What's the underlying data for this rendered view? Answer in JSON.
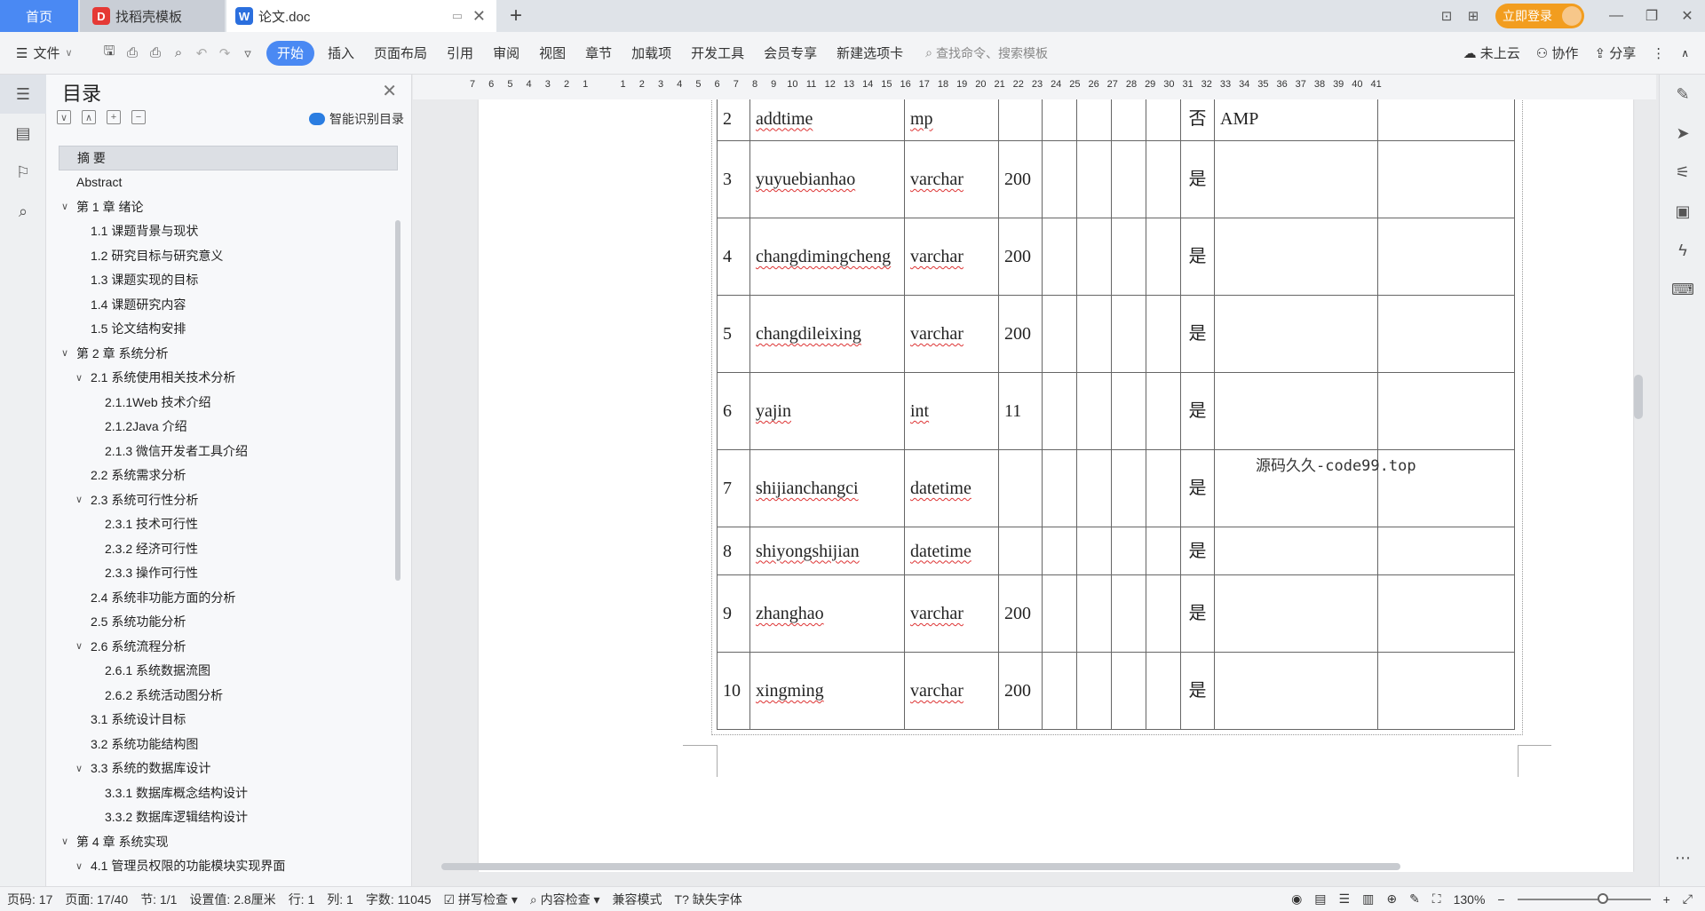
{
  "tabs": {
    "home": "首页",
    "daoke": "找稻壳模板",
    "doc": "论文.doc",
    "add": "+"
  },
  "window": {
    "login": "立即登录",
    "minimize": "—",
    "restore": "❐",
    "close": "✕"
  },
  "ribbon": {
    "file": "文件",
    "tabs": [
      "开始",
      "插入",
      "页面布局",
      "引用",
      "审阅",
      "视图",
      "章节",
      "加载项",
      "开发工具",
      "会员专享",
      "新建选项卡"
    ],
    "search_placeholder": "查找命令、搜索模板",
    "cloud": "未上云",
    "collab": "协作",
    "share": "分享"
  },
  "toc": {
    "title": "目录",
    "smart": "智能识别目录",
    "items": [
      {
        "label": "摘  要",
        "level": 0,
        "arrow": ""
      },
      {
        "label": "Abstract",
        "level": 0,
        "arrow": ""
      },
      {
        "label": "第 1 章  绪论",
        "level": 0,
        "arrow": "∨"
      },
      {
        "label": "1.1 课题背景与现状",
        "level": 1,
        "arrow": ""
      },
      {
        "label": "1.2 研究目标与研究意义",
        "level": 1,
        "arrow": ""
      },
      {
        "label": "1.3 课题实现的目标",
        "level": 1,
        "arrow": ""
      },
      {
        "label": "1.4  课题研究内容",
        "level": 1,
        "arrow": ""
      },
      {
        "label": "1.5  论文结构安排",
        "level": 1,
        "arrow": ""
      },
      {
        "label": "第 2 章  系统分析",
        "level": 0,
        "arrow": "∨"
      },
      {
        "label": "2.1 系统使用相关技术分析",
        "level": 1,
        "arrow": "∨"
      },
      {
        "label": "2.1.1Web 技术介绍",
        "level": 2,
        "arrow": ""
      },
      {
        "label": "2.1.2Java 介绍",
        "level": 2,
        "arrow": ""
      },
      {
        "label": "2.1.3 微信开发者工具介绍",
        "level": 2,
        "arrow": ""
      },
      {
        "label": "2.2 系统需求分析",
        "level": 1,
        "arrow": ""
      },
      {
        "label": "2.3 系统可行性分析",
        "level": 1,
        "arrow": "∨"
      },
      {
        "label": "2.3.1 技术可行性",
        "level": 2,
        "arrow": ""
      },
      {
        "label": "2.3.2 经济可行性",
        "level": 2,
        "arrow": ""
      },
      {
        "label": "2.3.3 操作可行性",
        "level": 2,
        "arrow": ""
      },
      {
        "label": "2.4 系统非功能方面的分析",
        "level": 1,
        "arrow": ""
      },
      {
        "label": "2.5 系统功能分析",
        "level": 1,
        "arrow": ""
      },
      {
        "label": "2.6 系统流程分析",
        "level": 1,
        "arrow": "∨"
      },
      {
        "label": "2.6.1 系统数据流图",
        "level": 2,
        "arrow": ""
      },
      {
        "label": "2.6.2 系统活动图分析",
        "level": 2,
        "arrow": ""
      },
      {
        "label": "3.1 系统设计目标",
        "level": 1,
        "arrow": ""
      },
      {
        "label": "3.2 系统功能结构图",
        "level": 1,
        "arrow": ""
      },
      {
        "label": "3.3 系统的数据库设计",
        "level": 1,
        "arrow": "∨"
      },
      {
        "label": "3.3.1 数据库概念结构设计",
        "level": 2,
        "arrow": ""
      },
      {
        "label": "3.3.2 数据库逻辑结构设计",
        "level": 2,
        "arrow": ""
      },
      {
        "label": "第 4 章  系统实现",
        "level": 0,
        "arrow": "∨"
      },
      {
        "label": "4.1  管理员权限的功能模块实现界面",
        "level": 1,
        "arrow": "∨"
      }
    ]
  },
  "ruler": [
    "7",
    "6",
    "5",
    "4",
    "3",
    "2",
    "1",
    "",
    "1",
    "2",
    "3",
    "4",
    "5",
    "6",
    "7",
    "8",
    "9",
    "10",
    "11",
    "12",
    "13",
    "14",
    "15",
    "16",
    "17",
    "18",
    "19",
    "20",
    "21",
    "22",
    "23",
    "24",
    "25",
    "26",
    "27",
    "28",
    "29",
    "30",
    "31",
    "32",
    "33",
    "34",
    "35",
    "36",
    "37",
    "38",
    "39",
    "40",
    "41"
  ],
  "table": {
    "rows": [
      [
        "2",
        "addtime",
        "mp",
        "",
        "",
        "",
        "",
        "",
        "否",
        "AMP",
        ""
      ],
      [
        "3",
        "yuyuebianhao",
        "varchar",
        "200",
        "",
        "",
        "",
        "",
        "是",
        "",
        ""
      ],
      [
        "4",
        "changdimingcheng",
        "varchar",
        "200",
        "",
        "",
        "",
        "",
        "是",
        "",
        ""
      ],
      [
        "5",
        "changdileixing",
        "varchar",
        "200",
        "",
        "",
        "",
        "",
        "是",
        "",
        ""
      ],
      [
        "6",
        "yajin",
        "int",
        "11",
        "",
        "",
        "",
        "",
        "是",
        "",
        ""
      ],
      [
        "7",
        "shijianchangci",
        "datetime",
        "",
        "",
        "",
        "",
        "",
        "是",
        "",
        ""
      ],
      [
        "8",
        "shiyongshijian",
        "datetime",
        "",
        "",
        "",
        "",
        "",
        "是",
        "",
        ""
      ],
      [
        "9",
        "zhanghao",
        "varchar",
        "200",
        "",
        "",
        "",
        "",
        "是",
        "",
        ""
      ],
      [
        "10",
        "xingming",
        "varchar",
        "200",
        "",
        "",
        "",
        "",
        "是",
        "",
        ""
      ]
    ],
    "watermark": "源码久久-code99.top"
  },
  "status": {
    "page": "页码: 17",
    "pages": "页面: 17/40",
    "section": "节: 1/1",
    "setting": "设置值: 2.8厘米",
    "row": "行: 1",
    "col": "列: 1",
    "words": "字数: 11045",
    "spell": "拼写检查",
    "content": "内容检查",
    "compat": "兼容模式",
    "font_missing": "缺失字体",
    "zoom": "130%"
  }
}
